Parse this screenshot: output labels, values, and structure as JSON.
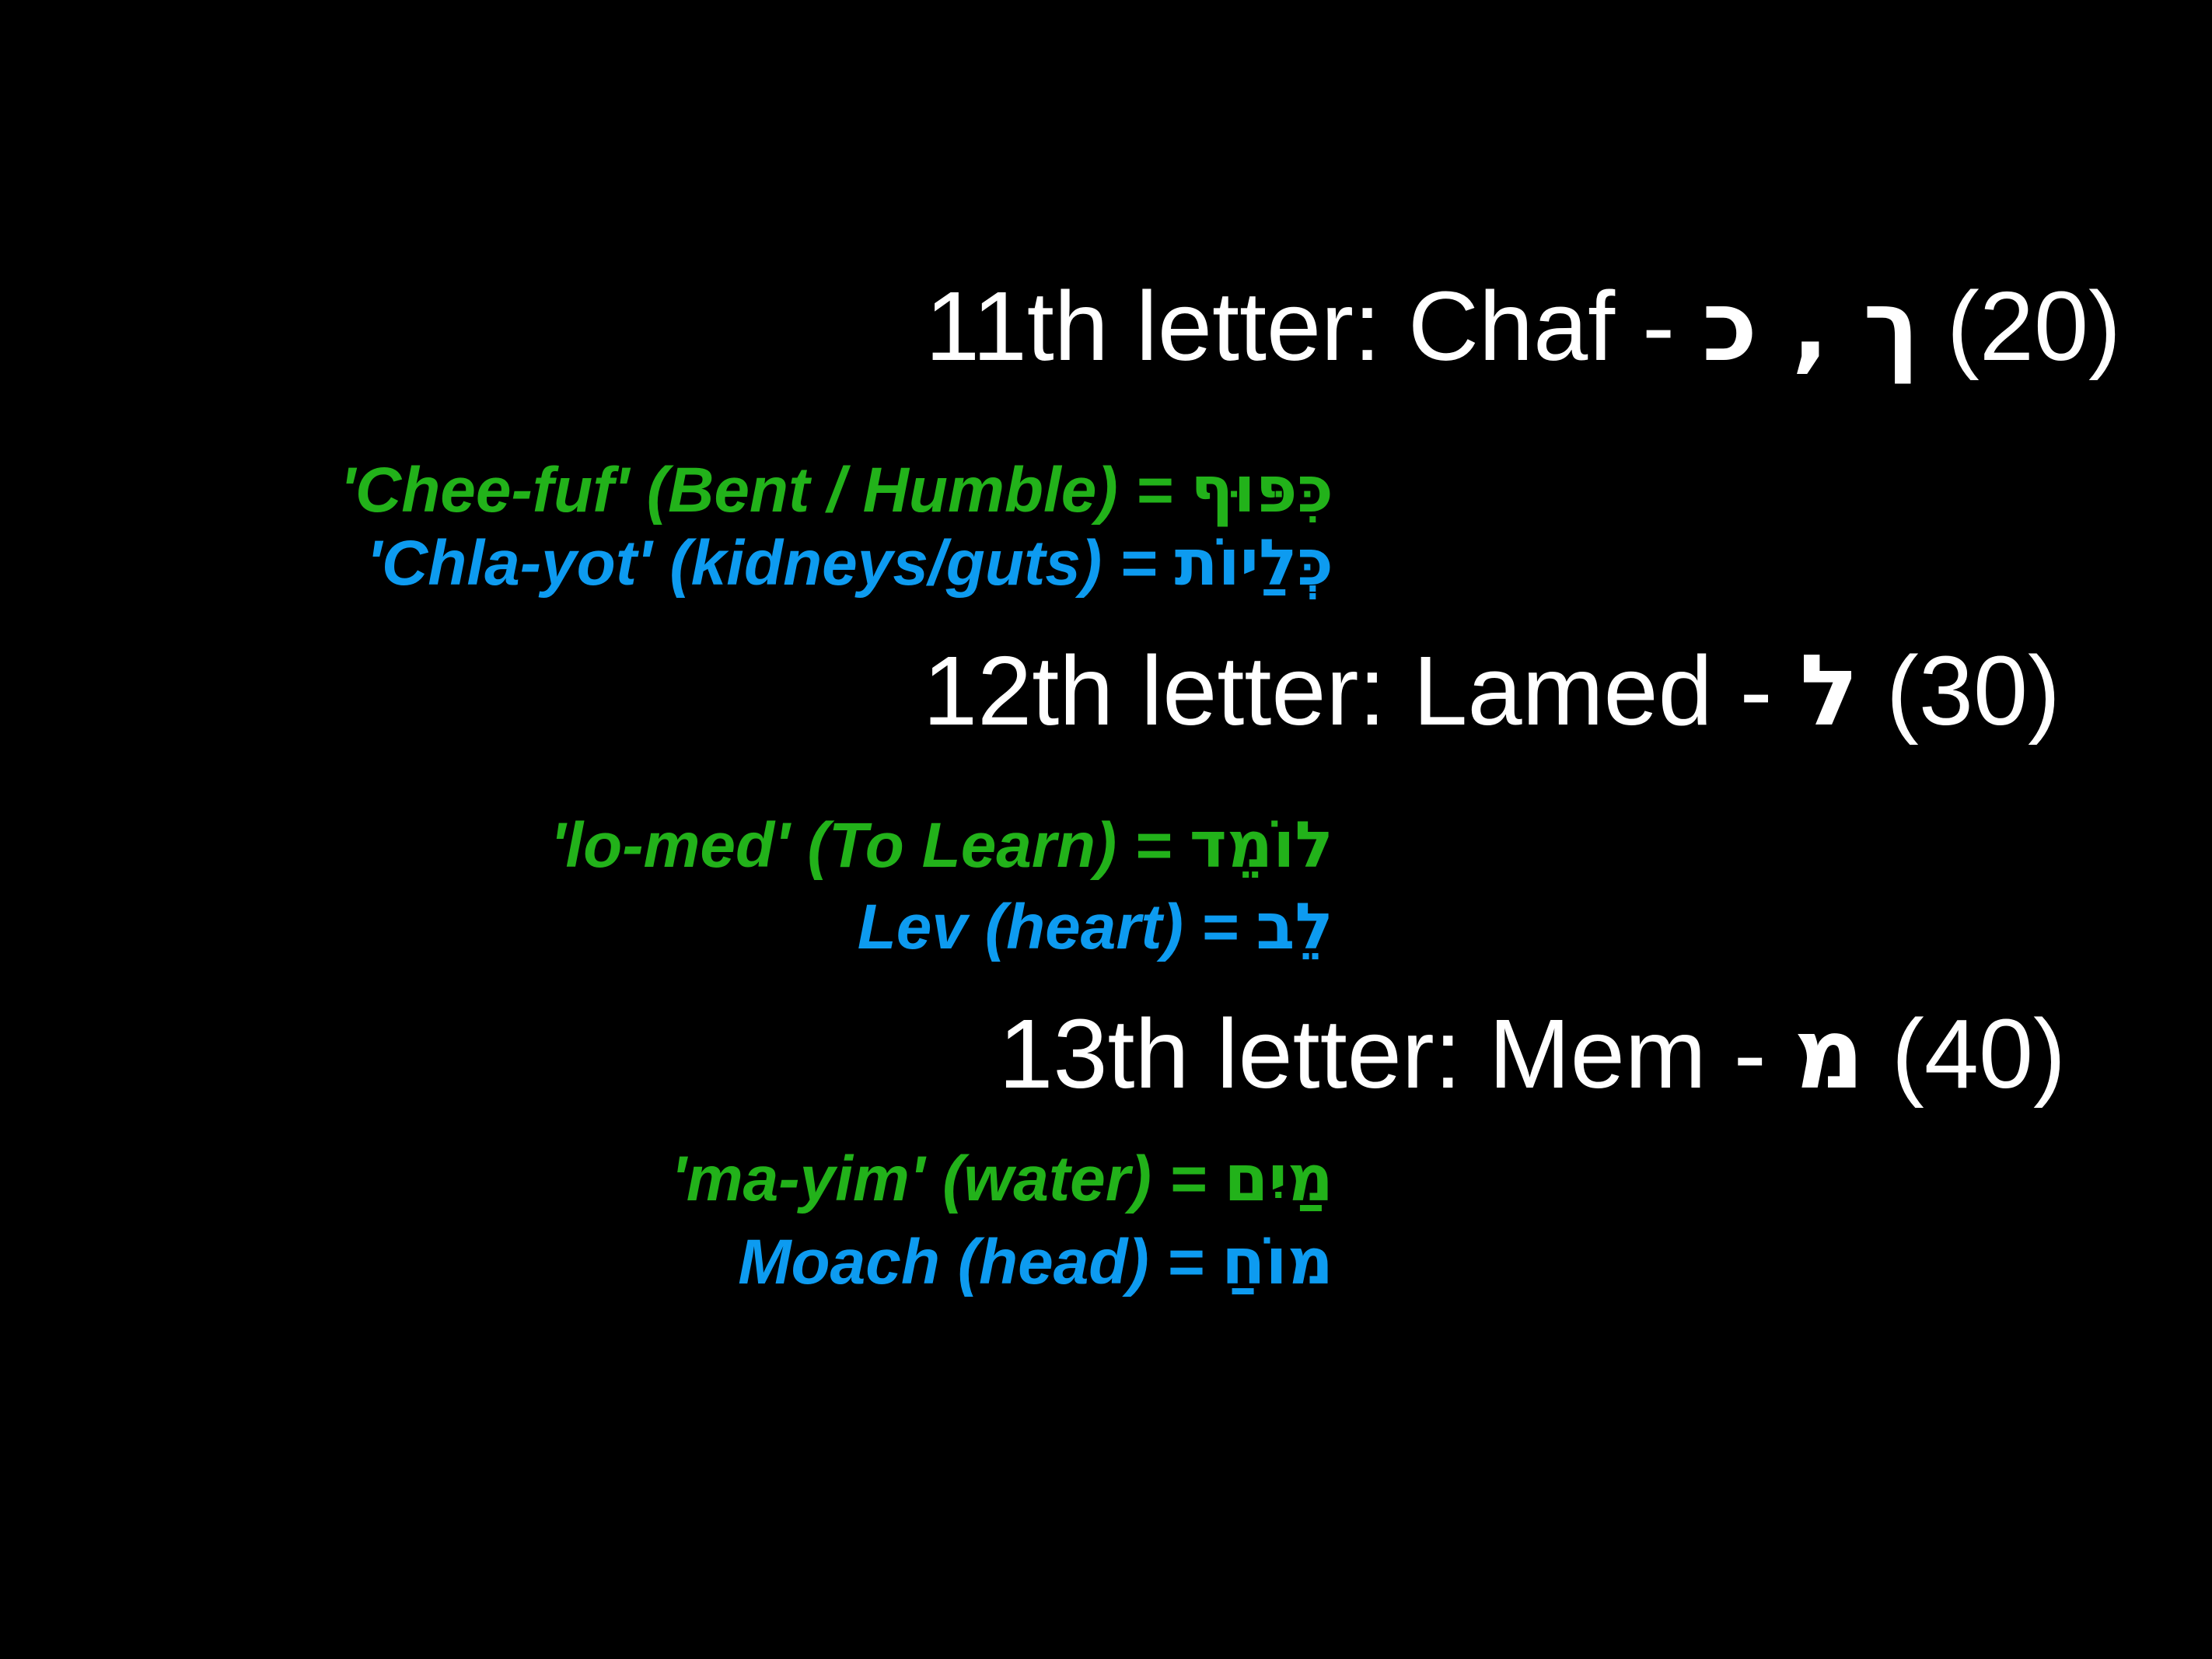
{
  "slide": {
    "background": "#000000",
    "text_color": "#ffffff",
    "green": "#22b21a",
    "blue": "#0d9bf0"
  },
  "letters": [
    {
      "heading_label": "11th letter: Chaf   -",
      "heading_hebrew": "ך , כ",
      "heading_value": "(20)",
      "word1_translit": "'Chee-fuf' (Bent / Humble) =",
      "word1_hebrew": "כִּפּוּף",
      "word2_translit": "'Chla-yot' (kidneys/guts) =",
      "word2_hebrew": "כְּלַיוֹת"
    },
    {
      "heading_label": "12th letter: Lamed -",
      "heading_hebrew": "ל",
      "heading_value": "(30)",
      "word1_translit": "'lo-med' (To Learn) =",
      "word1_hebrew": "לוֹמֵד",
      "word2_translit": "Lev (heart) =",
      "word2_hebrew": "לֵב"
    },
    {
      "heading_label": "13th letter: Mem   -",
      "heading_hebrew": "מ",
      "heading_value": "(40)",
      "word1_translit": "'ma-yim' (water) =",
      "word1_hebrew": "מַיִם",
      "word2_translit": "Moach (head) =",
      "word2_hebrew": "מוֹחַ"
    }
  ]
}
